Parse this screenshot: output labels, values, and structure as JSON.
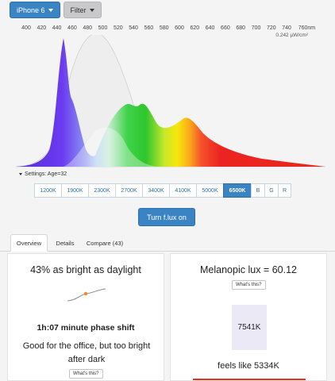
{
  "toolbar": {
    "device_label": "iPhone 6",
    "filter_label": "Filter"
  },
  "spectrum": {
    "ticks": [
      "400",
      "420",
      "440",
      "460",
      "480",
      "500",
      "520",
      "540",
      "560",
      "580",
      "600",
      "620",
      "640",
      "660",
      "680",
      "700",
      "720",
      "740",
      "760nm"
    ],
    "unit_label": "0.242 µW/cm²"
  },
  "settings": {
    "label": "Settings: Age=32"
  },
  "temperature_buttons": [
    {
      "label": "1200K",
      "active": false
    },
    {
      "label": "1900K",
      "active": false
    },
    {
      "label": "2300K",
      "active": false
    },
    {
      "label": "2700K",
      "active": false
    },
    {
      "label": "3400K",
      "active": false
    },
    {
      "label": "4100K",
      "active": false
    },
    {
      "label": "5000K",
      "active": false
    },
    {
      "label": "6500K",
      "active": true
    },
    {
      "label": "B",
      "active": false
    },
    {
      "label": "G",
      "active": false
    },
    {
      "label": "R",
      "active": false
    }
  ],
  "flux_button": "Turn f.lux on",
  "tabs": {
    "overview": "Overview",
    "details": "Details",
    "compare": "Compare (43)"
  },
  "left_card": {
    "brightness": "43% as bright as daylight",
    "phase_shift": "1h:07 minute phase shift",
    "advice": "Good for the office, but too bright after dark",
    "whats_this": "What's this?"
  },
  "right_card": {
    "melanopic": "Melanopic lux = 60.12",
    "whats_this": "What's this?",
    "kelvin": "7541K",
    "feels_like": "feels like 5334K"
  },
  "colors": {
    "accent": "#3b84c4",
    "feels_bar": "#e5321c"
  }
}
